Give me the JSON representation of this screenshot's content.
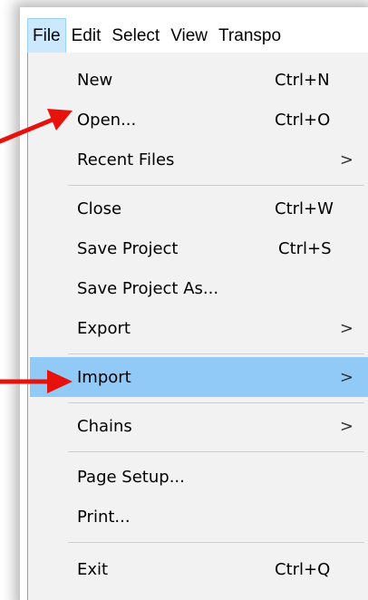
{
  "menubar": {
    "items": [
      "File",
      "Edit",
      "Select",
      "View",
      "Transpo"
    ]
  },
  "file_menu": {
    "items": [
      {
        "label": "New",
        "shortcut": "Ctrl+N",
        "submenu": false
      },
      {
        "label": "Open...",
        "shortcut": "Ctrl+O",
        "submenu": false
      },
      {
        "label": "Recent Files",
        "shortcut": "",
        "submenu": true
      },
      {
        "label": "Close",
        "shortcut": "Ctrl+W",
        "submenu": false
      },
      {
        "label": "Save Project",
        "shortcut": "Ctrl+S",
        "submenu": false
      },
      {
        "label": "Save Project As...",
        "shortcut": "",
        "submenu": false
      },
      {
        "label": "Export",
        "shortcut": "",
        "submenu": true
      },
      {
        "label": "Import",
        "shortcut": "",
        "submenu": true
      },
      {
        "label": "Chains",
        "shortcut": "",
        "submenu": true
      },
      {
        "label": "Page Setup...",
        "shortcut": "",
        "submenu": false
      },
      {
        "label": "Print...",
        "shortcut": "",
        "submenu": false
      },
      {
        "label": "Exit",
        "shortcut": "Ctrl+Q",
        "submenu": false
      }
    ],
    "submenu_glyph": ">"
  },
  "colors": {
    "menu_background": "#f2f2f2",
    "highlight": "#91c9f7",
    "active_menubar": "#cce8ff",
    "annotation_arrow": "#e8120c"
  },
  "icons": {
    "annotation": "red-arrow-icon"
  }
}
